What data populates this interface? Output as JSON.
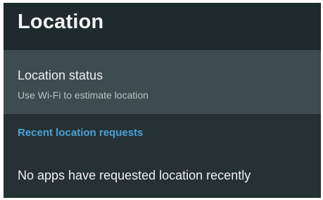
{
  "header": {
    "title": "Location"
  },
  "location_status": {
    "title": "Location status",
    "summary": "Use Wi-Fi to estimate location"
  },
  "recent_requests": {
    "header": "Recent location requests",
    "empty_message": "No apps have requested location recently"
  },
  "colors": {
    "header_background": "#1e2a2c",
    "panel_background": "#253133",
    "selected_item_background": "#3d4c4f",
    "accent": "#4ba3d9",
    "primary_text": "#eef1f1",
    "secondary_text": "#b9c3c3"
  }
}
